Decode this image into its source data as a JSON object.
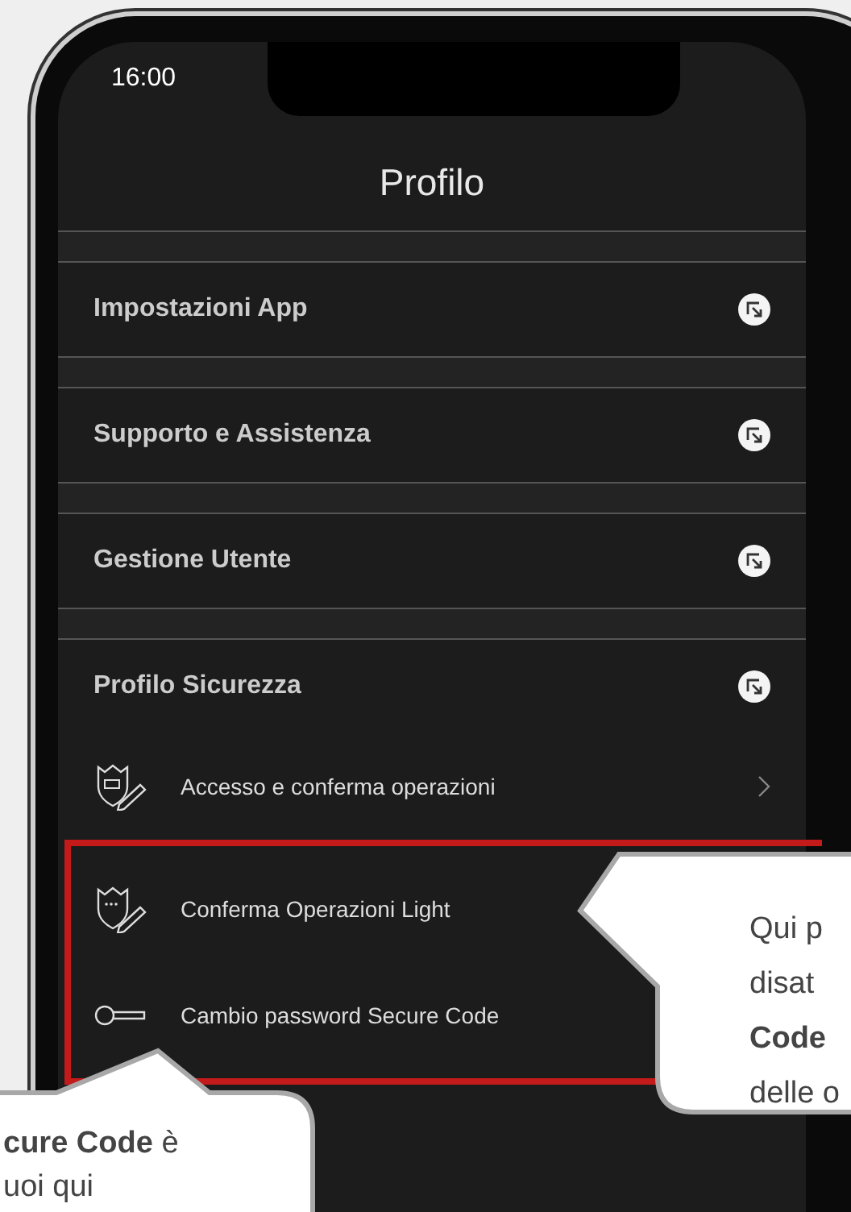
{
  "status_bar": {
    "time": "16:00"
  },
  "header": {
    "title": "Profilo"
  },
  "sections": [
    {
      "label": "Impostazioni App"
    },
    {
      "label": "Supporto e Assistenza"
    },
    {
      "label": "Gestione Utente"
    },
    {
      "label": "Profilo Sicurezza",
      "items": [
        {
          "label": "Accesso e conferma operazioni",
          "kind": "shield-card",
          "chevron": true,
          "highlighted": false
        },
        {
          "label": "Conferma Operazioni Light",
          "kind": "shield-dots",
          "chevron": false,
          "highlighted": true
        },
        {
          "label": "Cambio password Secure Code",
          "kind": "key",
          "chevron": false,
          "highlighted": true
        }
      ]
    }
  ],
  "callouts": [
    {
      "lines": [
        "Qui p",
        "disat",
        "**Code**",
        "delle o"
      ]
    },
    {
      "lines": [
        "**cure Code** è",
        "uoi qui"
      ]
    }
  ]
}
